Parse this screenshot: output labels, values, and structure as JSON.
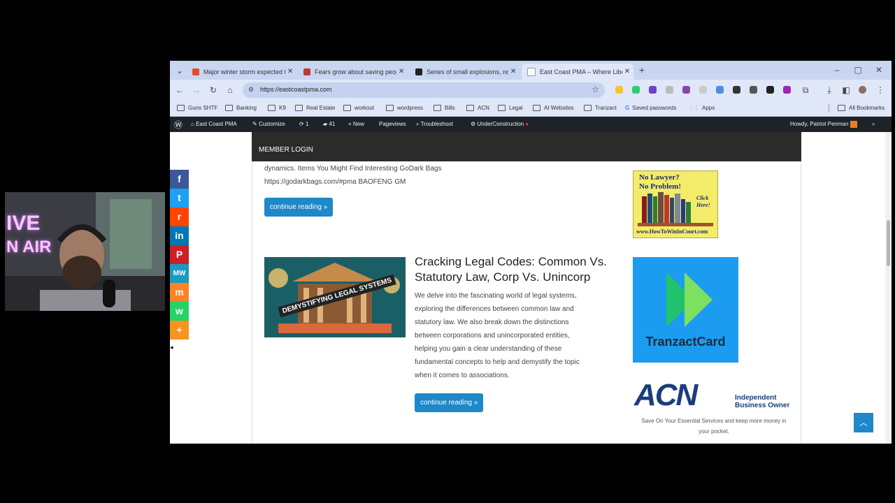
{
  "tabs": [
    {
      "title": "Major winter storm expected to",
      "favicon_color": "#e34c26"
    },
    {
      "title": "Fears grow about saving peopl",
      "favicon_color": "#c0392b"
    },
    {
      "title": "Series of small explosions, no in",
      "favicon_color": "#222222"
    },
    {
      "title": "East Coast PMA – Where Libert",
      "favicon_color": "#f0f0f0"
    }
  ],
  "toolbar": {
    "url": "https://eastcoastpma.com"
  },
  "bookmarks": [
    {
      "label": "Guns SHTF",
      "icon": "folder-icon"
    },
    {
      "label": "Banking",
      "icon": "folder-icon"
    },
    {
      "label": "K9",
      "icon": "folder-icon"
    },
    {
      "label": "Real Estate",
      "icon": "folder-icon"
    },
    {
      "label": "workout",
      "icon": "folder-icon"
    },
    {
      "label": "wordpress",
      "icon": "folder-icon"
    },
    {
      "label": "Bills",
      "icon": "folder-icon"
    },
    {
      "label": "ACN",
      "icon": "folder-icon"
    },
    {
      "label": "Legal",
      "icon": "folder-icon"
    },
    {
      "label": "AI Websites",
      "icon": "folder-icon"
    },
    {
      "label": "Tranzact",
      "icon": "folder-icon"
    },
    {
      "label": "Saved passwords",
      "icon": "google-icon"
    },
    {
      "label": "Apps",
      "icon": "apps-grid-icon"
    }
  ],
  "all_bookmarks": "All Bookmarks",
  "adminbar": {
    "site_name": "East Coast PMA",
    "customize": "Customize",
    "updates_count": "1",
    "comments_count": "41",
    "new": "New",
    "pageviews": "Pageviews",
    "troubleshoot": "Troubleshoot",
    "under_construction": "UnderConstruction",
    "howdy": "Howdy, Patriot Penman"
  },
  "member_login": "MEMBER LOGIN",
  "posts": [
    {
      "excerpt_line1": "dynamics. Items You Might Find Interesting GoDark Bags",
      "excerpt_line2": "https://godarkbags.com/#pma BAOFENG GM",
      "button": "continue reading"
    },
    {
      "title_line1": "Cracking Legal Codes: Common Vs.",
      "title_line2": "Statutory Law, Corp Vs. Unincorp",
      "image_caption": "DEMYSTIFYING LEGAL SYSTEMS",
      "excerpt_lines": [
        "We delve into the fascinating world of legal systems,",
        "exploring the differences between common law and",
        "statutory law. We also break down the distinctions",
        "between corporations and unincorporated entities,",
        "helping you gain a clear understanding of these",
        "fundamental concepts to help and demystify the topic",
        "when it comes to associations."
      ],
      "button": "continue reading"
    }
  ],
  "sidebar": {
    "ad1": {
      "line1": "No Lawyer?",
      "line2": "No Problem!",
      "click": "Click",
      "here": "Here!",
      "url": "www.HowToWinInCourt.com"
    },
    "ad2": {
      "name": "TranzactCard"
    },
    "ad3": {
      "logo": "ACN",
      "tag1": "Independent",
      "tag2": "Business Owner",
      "caption_line1": "Save On Your Essential Services and keep more money in",
      "caption_line2": "your pocket."
    }
  },
  "share_buttons": [
    {
      "name": "facebook",
      "glyph": "f",
      "color": "#3b5998"
    },
    {
      "name": "twitter",
      "glyph": "t",
      "color": "#1da1f2"
    },
    {
      "name": "reddit",
      "glyph": "r",
      "color": "#ff4500"
    },
    {
      "name": "linkedin",
      "glyph": "in",
      "color": "#0077b5"
    },
    {
      "name": "pinterest",
      "glyph": "P",
      "color": "#cb2027"
    },
    {
      "name": "mewe",
      "glyph": "MW",
      "color": "#1c9abf"
    },
    {
      "name": "mix",
      "glyph": "m",
      "color": "#ff8226"
    },
    {
      "name": "whatsapp",
      "glyph": "w",
      "color": "#25d366"
    },
    {
      "name": "more",
      "glyph": "+",
      "color": "#f7941d"
    }
  ],
  "webcam": {
    "neon_line1": "IVE",
    "neon_line2": "N AIR"
  }
}
